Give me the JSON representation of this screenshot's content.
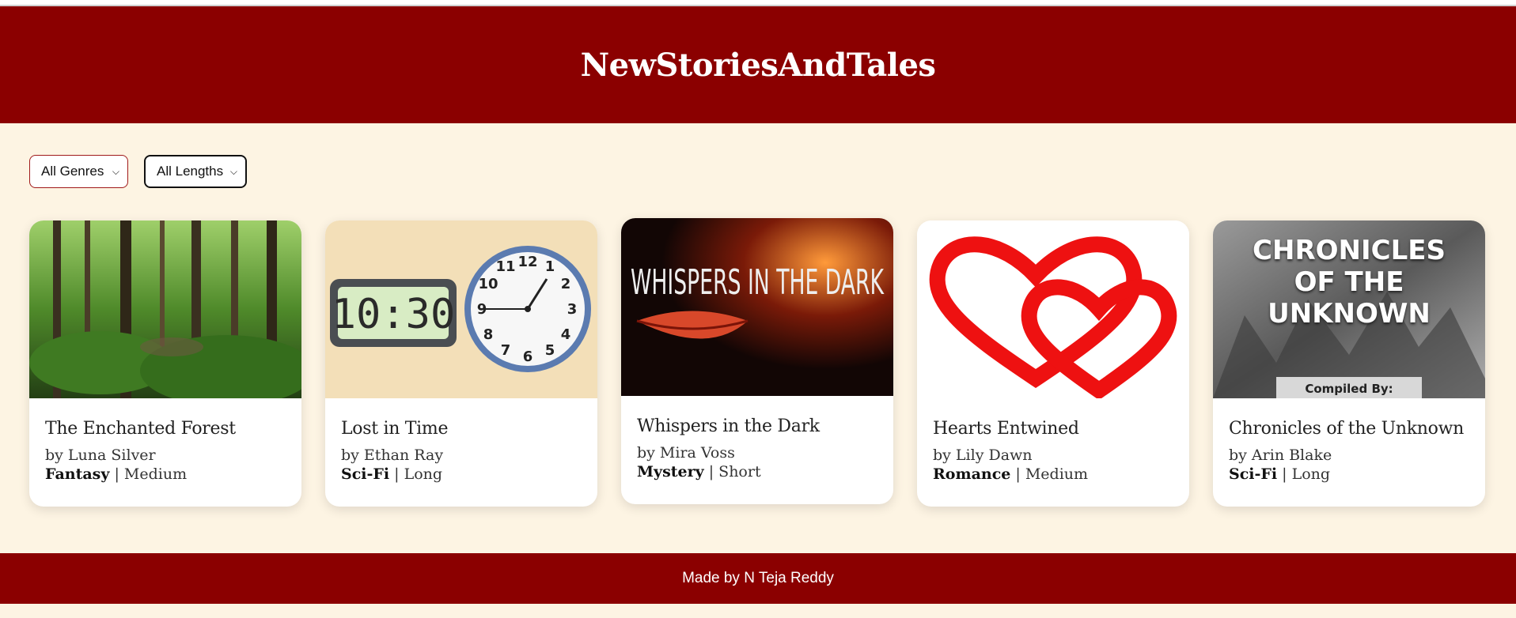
{
  "header": {
    "title": "NewStoriesAndTales"
  },
  "filters": {
    "genre": {
      "selected": "All Genres",
      "options": [
        "All Genres"
      ]
    },
    "length": {
      "selected": "All Lengths",
      "options": [
        "All Lengths"
      ]
    }
  },
  "stories": [
    {
      "title": "The Enchanted Forest",
      "author": "by Luna Silver",
      "genre": "Fantasy",
      "length": "Medium",
      "image": "forest-image"
    },
    {
      "title": "Lost in Time",
      "author": "by Ethan Ray",
      "genre": "Sci-Fi",
      "length": "Long",
      "image": "clock-image",
      "clock_text": "10:30"
    },
    {
      "title": "Whispers in the Dark",
      "author": "by Mira Voss",
      "genre": "Mystery",
      "length": "Short",
      "image": "whispers-cover",
      "cover_text": "WHISPERS IN THE DARK"
    },
    {
      "title": "Hearts Entwined",
      "author": "by Lily Dawn",
      "genre": "Romance",
      "length": "Medium",
      "image": "hearts-image"
    },
    {
      "title": "Chronicles of the Unknown",
      "author": "by Arin Blake",
      "genre": "Sci-Fi",
      "length": "Long",
      "image": "chronicles-cover",
      "cover_text": "CHRONICLES OF THE UNKNOWN",
      "cover_sub": "Compiled By:"
    }
  ],
  "footer": {
    "text": "Made by N Teja Reddy"
  },
  "colors": {
    "brand": "#8b0000",
    "background": "#fdf4e3",
    "card": "#ffffff"
  }
}
